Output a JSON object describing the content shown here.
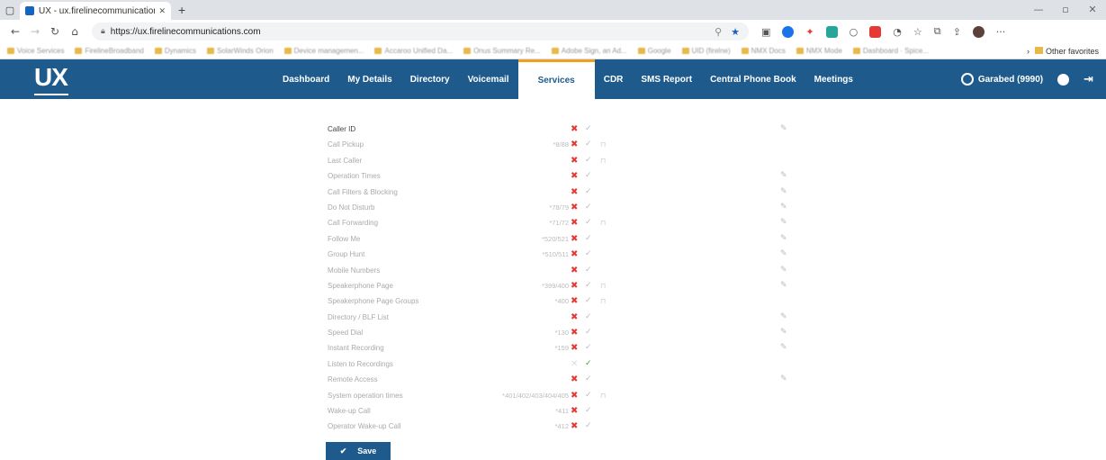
{
  "browser": {
    "tab_title": "UX - ux.firelinecommunications.c",
    "url": "https://ux.firelinecommunications.com",
    "bookmarks": [
      "Voice Services",
      "FirelineBroadband",
      "Dynamics",
      "SolarWinds Orion",
      "Device managemen...",
      "Accaroo Unified Da...",
      "Onus Summary Re...",
      "Adobe Sign, an Ad...",
      "Google",
      "UID (firelne)",
      "NMX Docs",
      "NMX Mode",
      "Dashboard · Spice..."
    ],
    "other_favorites": "Other favorites"
  },
  "app": {
    "logo": "UX",
    "menu": [
      {
        "label": "Dashboard",
        "active": false
      },
      {
        "label": "My Details",
        "active": false
      },
      {
        "label": "Directory",
        "active": false
      },
      {
        "label": "Voicemail",
        "active": false
      },
      {
        "label": "Services",
        "active": true
      },
      {
        "label": "CDR",
        "active": false
      },
      {
        "label": "SMS Report",
        "active": false
      },
      {
        "label": "Central Phone Book",
        "active": false
      },
      {
        "label": "Meetings",
        "active": false
      }
    ],
    "user_label": "Garabed (9990)"
  },
  "services": [
    {
      "name": "Caller ID",
      "code": "",
      "status": "x",
      "lock": false,
      "edit": true
    },
    {
      "name": "Call Pickup",
      "code": "*8/88",
      "status": "x",
      "lock": true,
      "edit": false
    },
    {
      "name": "Last Caller",
      "code": "",
      "status": "x",
      "lock": true,
      "edit": false
    },
    {
      "name": "Operation Times",
      "code": "",
      "status": "x",
      "lock": false,
      "edit": true
    },
    {
      "name": "Call Filters & Blocking",
      "code": "",
      "status": "x",
      "lock": false,
      "edit": true
    },
    {
      "name": "Do Not Disturb",
      "code": "*78/79",
      "status": "x",
      "lock": false,
      "edit": true
    },
    {
      "name": "Call Forwarding",
      "code": "*71/72",
      "status": "x",
      "lock": true,
      "edit": true
    },
    {
      "name": "Follow Me",
      "code": "*520/521",
      "status": "x",
      "lock": false,
      "edit": true
    },
    {
      "name": "Group Hunt",
      "code": "*510/511",
      "status": "x",
      "lock": false,
      "edit": true
    },
    {
      "name": "Mobile Numbers",
      "code": "",
      "status": "x",
      "lock": false,
      "edit": true
    },
    {
      "name": "Speakerphone Page",
      "code": "*399/400",
      "status": "x",
      "lock": true,
      "edit": true
    },
    {
      "name": "Speakerphone Page Groups",
      "code": "*400",
      "status": "x",
      "lock": true,
      "edit": false
    },
    {
      "name": "Directory / BLF List",
      "code": "",
      "status": "x",
      "lock": false,
      "edit": true
    },
    {
      "name": "Speed Dial",
      "code": "*130",
      "status": "x",
      "lock": false,
      "edit": true
    },
    {
      "name": "Instant Recording",
      "code": "*159",
      "status": "x",
      "lock": false,
      "edit": true
    },
    {
      "name": "Listen to Recordings",
      "code": "",
      "status": "check",
      "lock": false,
      "edit": false
    },
    {
      "name": "Remote Access",
      "code": "",
      "status": "x",
      "lock": false,
      "edit": true
    },
    {
      "name": "System operation times",
      "code": "*401/402/403/404/405",
      "status": "x",
      "lock": true,
      "edit": false
    },
    {
      "name": "Wake-up Call",
      "code": "*411",
      "status": "x",
      "lock": false,
      "edit": false
    },
    {
      "name": "Operator Wake-up Call",
      "code": "*412",
      "status": "x",
      "lock": false,
      "edit": false
    }
  ],
  "save_label": "Save",
  "colors": {
    "nav_bg": "#1e5b8c",
    "active_accent": "#f0a020",
    "disabled_x": "#e53935",
    "enabled_check": "#43a047"
  }
}
